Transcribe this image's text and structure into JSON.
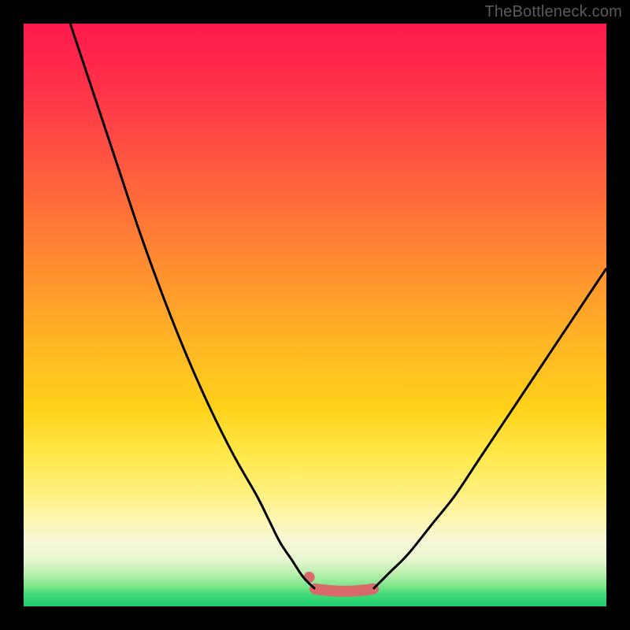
{
  "watermark": "TheBottleneck.com",
  "chart_data": {
    "type": "line",
    "title": "",
    "xlabel": "",
    "ylabel": "",
    "xlim": [
      0,
      100
    ],
    "ylim": [
      0,
      100
    ],
    "series": [
      {
        "name": "left-curve",
        "x": [
          8,
          12,
          16,
          20,
          24,
          28,
          32,
          36,
          40,
          42,
          44,
          46,
          48,
          50
        ],
        "y": [
          100,
          88,
          76,
          64,
          53,
          43,
          34,
          26,
          19,
          15,
          11,
          8,
          5,
          3
        ]
      },
      {
        "name": "right-curve",
        "x": [
          60,
          63,
          66,
          70,
          74,
          78,
          82,
          86,
          90,
          94,
          98,
          100
        ],
        "y": [
          3,
          6,
          9,
          14,
          19,
          25,
          31,
          37,
          43,
          49,
          55,
          58
        ]
      },
      {
        "name": "floor-span",
        "x": [
          50,
          55,
          60
        ],
        "y": [
          3,
          2.5,
          3
        ]
      }
    ],
    "markers": [
      {
        "name": "pink-dot-left",
        "x": 49,
        "y": 5
      }
    ],
    "floor_band": {
      "x0": 50,
      "x1": 60,
      "y": 3
    },
    "colors": {
      "curve": "#000000",
      "accent": "#d96a6a",
      "background_top": "#ff1a4d",
      "background_bottom": "#1fce6e"
    }
  }
}
